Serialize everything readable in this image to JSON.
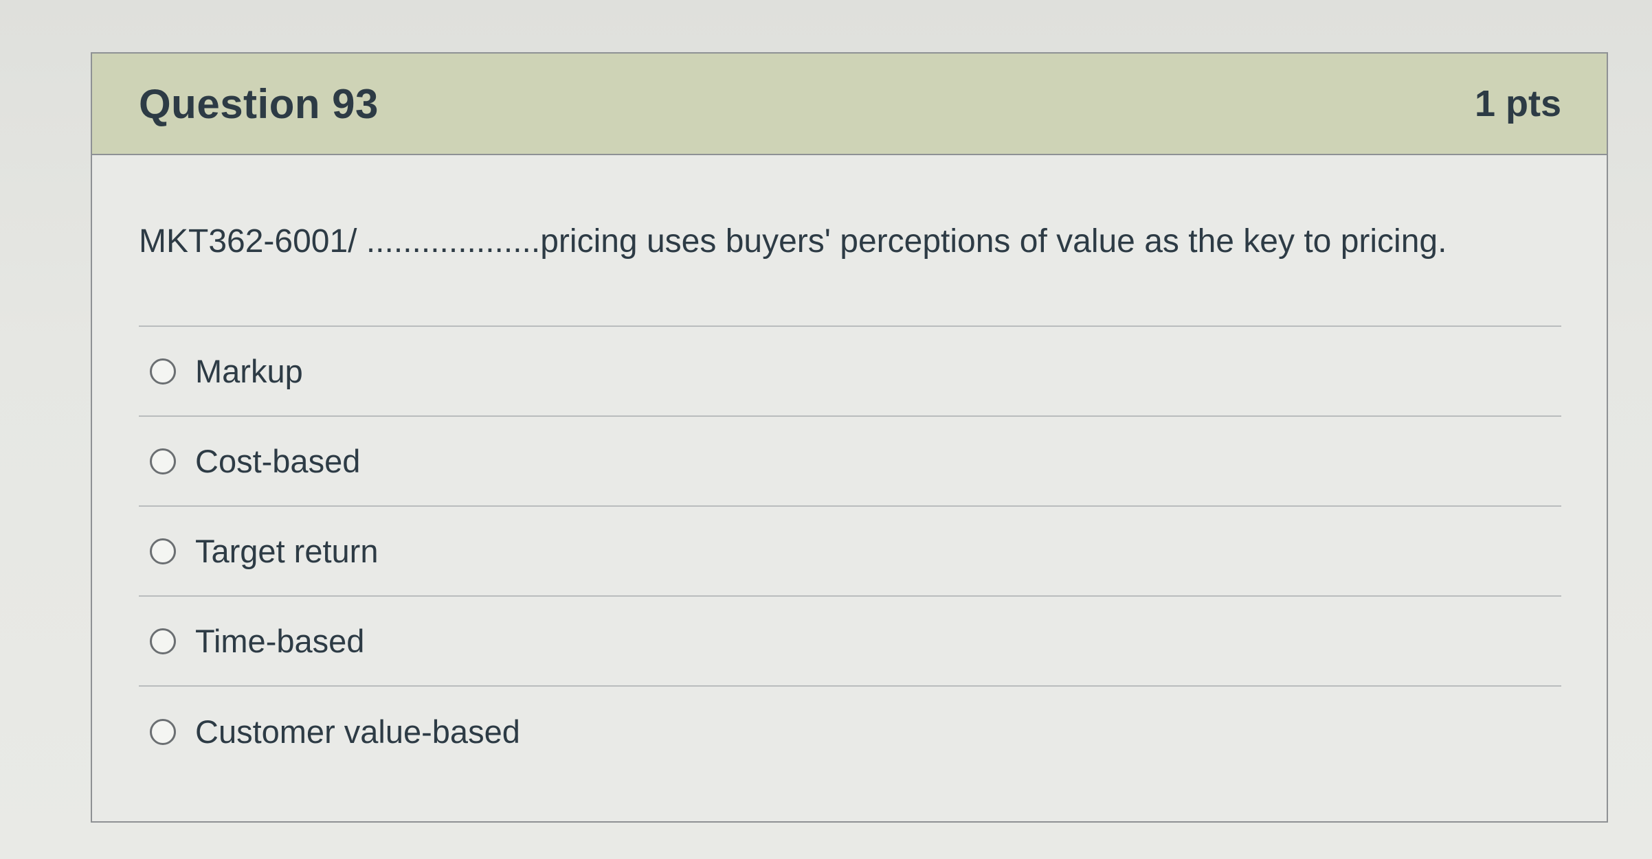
{
  "question": {
    "title": "Question 93",
    "points": "1 pts",
    "text": "MKT362-6001/ ...................pricing uses buyers' perceptions of value as the key to pricing."
  },
  "answers": [
    {
      "label": "Markup",
      "selected": false
    },
    {
      "label": "Cost-based",
      "selected": false
    },
    {
      "label": "Target return",
      "selected": false
    },
    {
      "label": "Time-based",
      "selected": false
    },
    {
      "label": "Customer value-based",
      "selected": false
    }
  ],
  "colors": {
    "header_background": "#ced3b6",
    "card_background": "#e9eae7",
    "text": "#2d3b45"
  }
}
